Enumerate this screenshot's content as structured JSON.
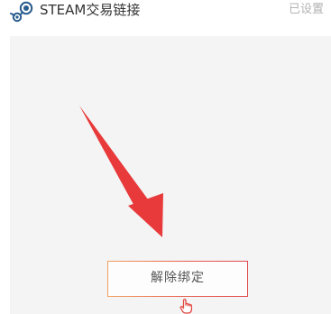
{
  "header": {
    "icon": "steam-icon",
    "title": "STEAM交易链接",
    "status": "已设置"
  },
  "panel": {
    "unbind_label": "解除绑定"
  },
  "annotation": {
    "arrow_icon": "red-arrow",
    "arrow_color": "#e83a3a",
    "pointer_icon": "hand-pointer-icon",
    "pointer_color": "#e2463f"
  },
  "colors": {
    "panel_bg": "#f4f4f5",
    "button_border_start": "#f2a25f",
    "button_border_end": "#e1474c",
    "status_text": "#b3b3b3"
  }
}
